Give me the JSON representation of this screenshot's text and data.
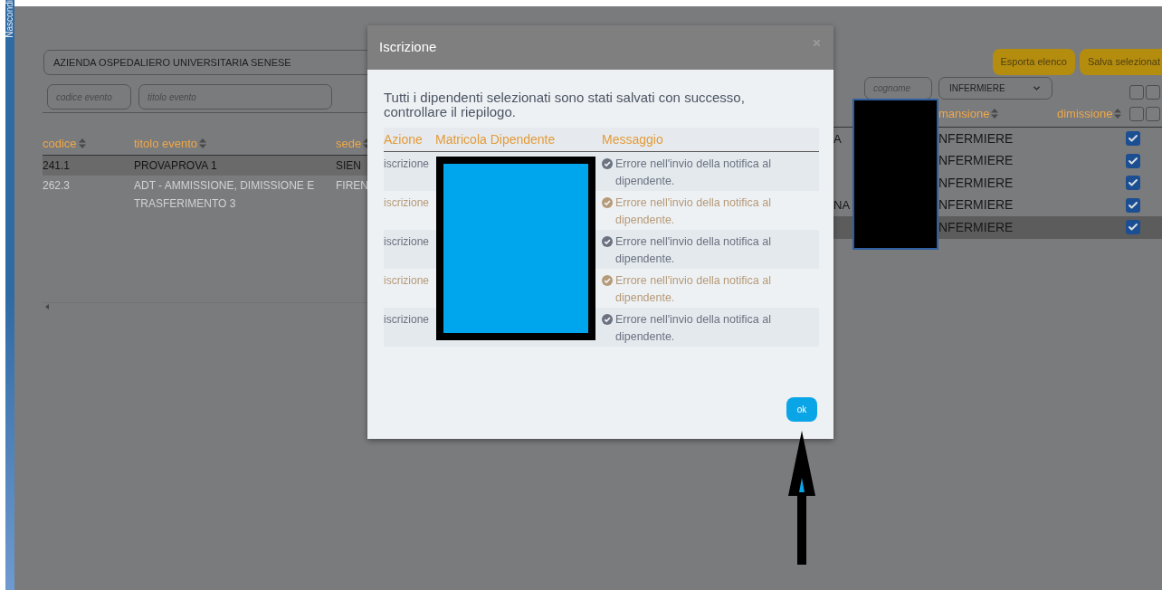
{
  "sidebar_toggle": {
    "label": "Nascondi"
  },
  "filters": {
    "azienda": {
      "value": "AZIENDA OSPEDALIERO UNIVERSITARIA SENESE"
    },
    "codice": {
      "placeholder": "codice evento"
    },
    "titolo": {
      "placeholder": "titolo evento"
    },
    "cognome": {
      "placeholder": "cognome"
    },
    "mansione": {
      "value": "INFERMIERE"
    }
  },
  "buttons": [
    "Esporta elenco",
    "Salva selezionat"
  ],
  "events_table": {
    "columns": [
      "codice",
      "titolo evento",
      "sede"
    ],
    "rows": [
      {
        "cells": [
          "241.1",
          "PROVAPROVA 1",
          "SIEN"
        ],
        "selected": true
      },
      {
        "cells": [
          "262.3",
          "ADT - AMMISSIONE, DIMISSIONE E TRASFERIMENTO 3",
          "FIREN"
        ],
        "selected": false
      }
    ]
  },
  "staff_table": {
    "filter_checkboxes": [
      {
        "checked": false
      },
      {
        "checked": false
      }
    ],
    "columns": [
      "mansione",
      "dimissione"
    ],
    "header_checkboxes": [
      {
        "checked": false
      },
      {
        "checked": false
      }
    ],
    "rows": [
      {
        "column_1": "A",
        "mansione": "NFERMIERE",
        "checked": true,
        "selected": false
      },
      {
        "mansione": "NFERMIERE",
        "checked": true,
        "selected": false
      },
      {
        "mansione": "NFERMIERE",
        "checked": true,
        "selected": false
      },
      {
        "column_1": "NA",
        "mansione": "NFERMIERE",
        "checked": true,
        "selected": false
      },
      {
        "mansione": "NFERMIERE",
        "checked": true,
        "selected": true
      }
    ]
  },
  "modal": {
    "title": "Iscrizione",
    "message": "Tutti i dipendenti selezionati sono stati salvati con successo, controllare il riepilogo.",
    "columns": [
      "Azione",
      "Matricola Dipendente",
      "Messaggio"
    ],
    "rows": [
      {
        "azione": "iscrizione",
        "messaggio": "Errore nell'invio della notifica al dipendente.",
        "kind": "plain"
      },
      {
        "azione": "iscrizione",
        "messaggio": "Errore nell'invio della notifica al dipendente.",
        "kind": "warning"
      },
      {
        "azione": "iscrizione",
        "messaggio": "Errore nell'invio della notifica al dipendente.",
        "kind": "plain"
      },
      {
        "azione": "iscrizione",
        "messaggio": "Errore nell'invio della notifica al dipendente.",
        "kind": "warning"
      },
      {
        "azione": "iscrizione",
        "messaggio": "Errore nell'invio della notifica al dipendente.",
        "kind": "plain"
      }
    ],
    "ok_button": "ok"
  }
}
